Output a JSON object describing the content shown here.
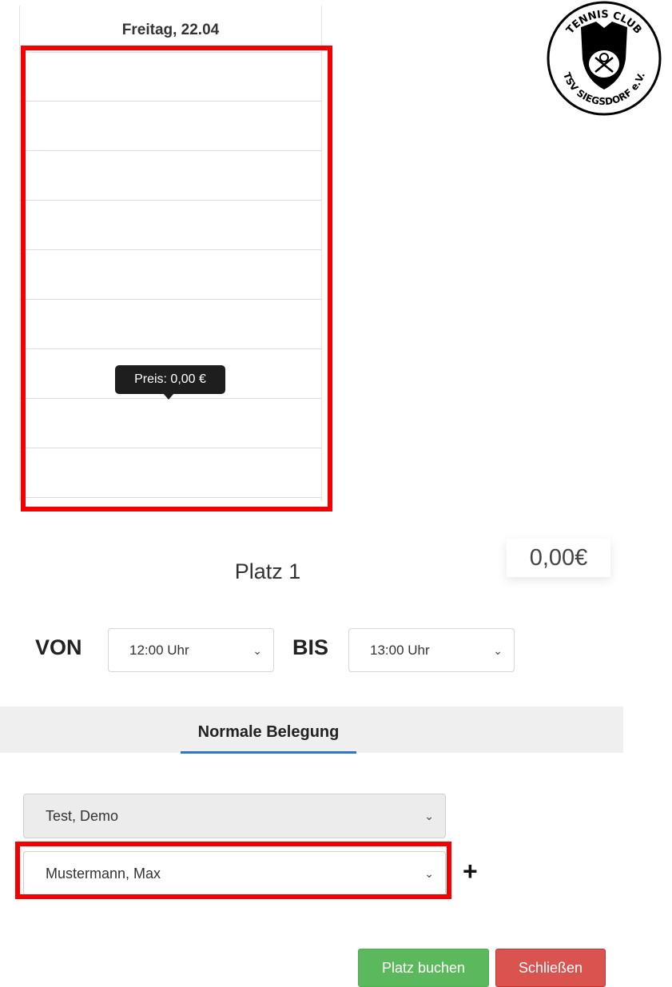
{
  "calendar": {
    "day_label": "Freitag, 22.04",
    "slot_count": 9,
    "tooltip": "Preis: 0,00 €"
  },
  "logo": {
    "top_text": "TENNIS CLUB",
    "bottom_text": "TSV SIEGSDORF e.V."
  },
  "booking": {
    "price": "0,00€",
    "court": "Platz 1",
    "von_label": "VON",
    "von_value": "12:00 Uhr",
    "bis_label": "BIS",
    "bis_value": "13:00 Uhr",
    "tab_label": "Normale Belegung",
    "player1": "Test, Demo",
    "player2": "Mustermann, Max",
    "add_icon": "+"
  },
  "buttons": {
    "book": "Platz buchen",
    "close": "Schließen"
  },
  "colors": {
    "highlight": "#f40000",
    "book_button": "#5cb85c",
    "close_button": "#d9534f",
    "tab_underline": "#2b79c2"
  }
}
